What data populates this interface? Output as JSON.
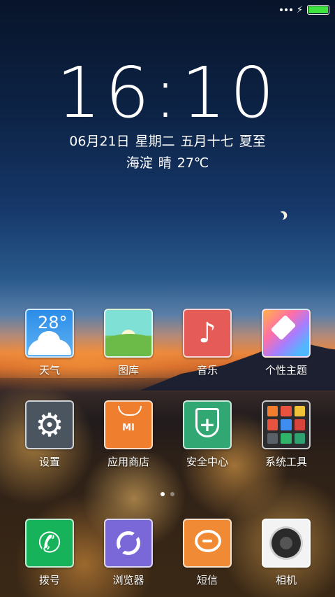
{
  "status_bar": {
    "battery_level": 100,
    "battery_color": "#3ee23e",
    "icons": [
      "more-dots-icon",
      "charging-bolt-icon",
      "battery-icon"
    ]
  },
  "lockclock": {
    "time": "16:10",
    "date_parts": [
      "06月21日",
      "星期二",
      "五月十七",
      "夏至"
    ],
    "weather_parts": [
      "海淀",
      "晴",
      "27℃"
    ]
  },
  "apps": [
    {
      "label": "天气",
      "icon": "weather-icon",
      "badge_text": "28°",
      "color": "#2b8de8"
    },
    {
      "label": "图库",
      "icon": "gallery-icon",
      "color": "#7fe0d6"
    },
    {
      "label": "音乐",
      "icon": "music-note-icon",
      "glyph": "♪",
      "color": "#e55b57"
    },
    {
      "label": "个性主题",
      "icon": "theme-brush-icon",
      "color": "#ff6ea8"
    },
    {
      "label": "设置",
      "icon": "gear-icon",
      "glyph": "⚙",
      "color": "#4a5560"
    },
    {
      "label": "应用商店",
      "icon": "mi-store-icon",
      "badge_text": "MI",
      "color": "#ef7e2e"
    },
    {
      "label": "安全中心",
      "icon": "shield-plus-icon",
      "glyph": "+",
      "color": "#31a874"
    },
    {
      "label": "系统工具",
      "icon": "tools-folder-icon",
      "color": "#2c2c2e"
    }
  ],
  "dock": [
    {
      "label": "拨号",
      "icon": "phone-icon",
      "glyph": "✆",
      "color": "#17b35a"
    },
    {
      "label": "浏览器",
      "icon": "browser-icon",
      "color": "#7b68d8"
    },
    {
      "label": "短信",
      "icon": "message-bubble-icon",
      "color": "#f08a34"
    },
    {
      "label": "相机",
      "icon": "camera-icon",
      "color": "#f3f3f3"
    }
  ],
  "pager": {
    "pages": 2,
    "active": 0
  }
}
